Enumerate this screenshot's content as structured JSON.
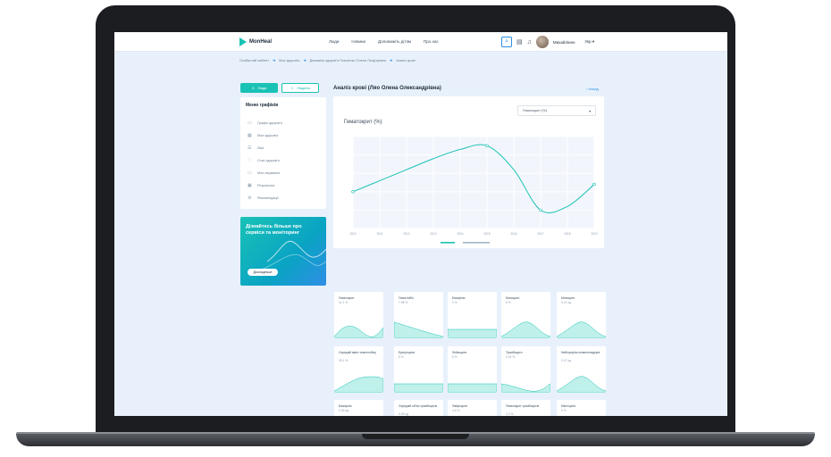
{
  "header": {
    "logo": "MonHeal",
    "nav": [
      "Люди",
      "Новини",
      "Допоможіть дітям",
      "Про нас"
    ],
    "user_name": "Михайлінен",
    "lang": "Укр"
  },
  "breadcrumb": [
    "Особистий кабінет",
    "Моє здоров'я",
    "Динаміка здоров'я Пташенко Олени Ланд'ярівни",
    "Аналіз крові"
  ],
  "sidebar": {
    "btn_list": "Люди",
    "btn_add": "Людина",
    "menu_title": "Меню графіків",
    "items": [
      {
        "label": "Графік здоров'я",
        "icon": "calendar-icon"
      },
      {
        "label": "Моє здоров'я",
        "icon": "grid-icon"
      },
      {
        "label": "Ліки",
        "icon": "list-icon"
      },
      {
        "label": "Стан здоров'я",
        "icon": "heart-icon"
      },
      {
        "label": "Моє лікування",
        "icon": "calendar-icon"
      },
      {
        "label": "Результати",
        "icon": "grid-icon"
      },
      {
        "label": "Рекомендації",
        "icon": "gear-icon"
      }
    ]
  },
  "promo": {
    "text": "Дізнайтесь більше про сервіси та моніторинг",
    "button": "Докладніше"
  },
  "main": {
    "title": "Аналіз крові (Ляо Олена Олександрівна)",
    "back": "‹ Назад",
    "select": "Гематокрит (%)",
    "chart_heading": "Гематокрит (%)"
  },
  "chart_data": {
    "type": "line",
    "title": "Гематокрит (%)",
    "x": [
      "2010",
      "2011",
      "2012",
      "2013",
      "2014",
      "2015",
      "2016",
      "2017",
      "2018",
      "2019"
    ],
    "series": [
      {
        "values": [
          35,
          38,
          41,
          44,
          46.5,
          47.5,
          41,
          30,
          31,
          37
        ]
      }
    ],
    "ylim": [
      25,
      50
    ],
    "grid": true,
    "legend": "bottom"
  },
  "tiles": [
    {
      "label": "Гематокрит",
      "value": "41.1 %",
      "shape": "hump-mid"
    },
    {
      "label": "Гемоглобін",
      "value": "7.98 %",
      "shape": "down"
    },
    {
      "label": "Базофіли",
      "value": "0 %",
      "shape": "flat"
    },
    {
      "label": "Моноцити",
      "value": "6 %",
      "shape": "hump"
    },
    {
      "label": "Моноцити",
      "value": "0.47 од",
      "shape": "hump"
    },
    {
      "label": "Середній вміст гемоглобіну",
      "value": "30.1 %",
      "shape": "rise"
    },
    {
      "label": "Еритроцити",
      "value": "5 %",
      "shape": "flat"
    },
    {
      "label": "Лейкоцити",
      "value": "6 %",
      "shape": "flat"
    },
    {
      "label": "Тромбоцити",
      "value": "0.44 %",
      "shape": "dip"
    },
    {
      "label": "Нейтрофіли сегментоядерні",
      "value": "2.47 од",
      "shape": "hump"
    },
    {
      "label": "Базофіли",
      "value": "0.35 од",
      "shape": "rise"
    },
    {
      "label": "Середній об'єм тромбоцитів",
      "value": "0.05 од",
      "shape": "rise"
    },
    {
      "label": "Лімфоцити",
      "value": "4.6 %",
      "shape": "rise-late"
    },
    {
      "label": "Гематокрит тромбоцитів",
      "value": "2.2 %",
      "shape": "down"
    },
    {
      "label": "Мієлоцити",
      "value": "0 %",
      "shape": "flat"
    }
  ],
  "colors": {
    "accent": "#19c2b5",
    "link": "#2f8ee5",
    "fill": "#bff0ea"
  }
}
